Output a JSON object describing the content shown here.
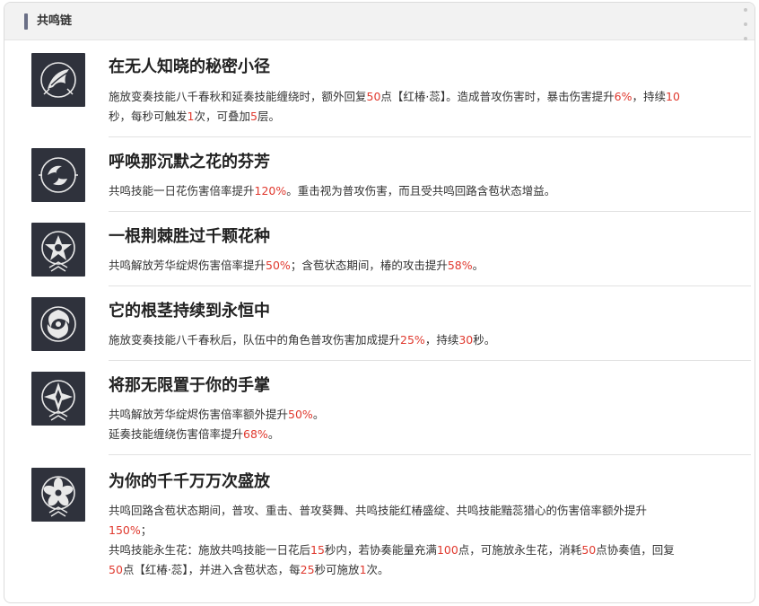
{
  "header": {
    "title": "共鸣链"
  },
  "items": [
    {
      "name": "在无人知晓的秘密小径",
      "icon": "wing-flower-icon",
      "lines": [
        [
          [
            "施放变奏技能八千春秋和延奏技能缠绕时，额外回复",
            false
          ],
          [
            "50",
            true
          ],
          [
            "点【红椿·蕊】。造成普攻伤害时，暴击伤害提升",
            false
          ],
          [
            "6%",
            true
          ],
          [
            "，持续",
            false
          ],
          [
            "10",
            true
          ]
        ],
        [
          [
            "秒，每秒可触发",
            false
          ],
          [
            "1",
            true
          ],
          [
            "次，可叠加",
            false
          ],
          [
            "5",
            true
          ],
          [
            "层。",
            false
          ]
        ]
      ]
    },
    {
      "name": "呼唤那沉默之花的芬芳",
      "icon": "swirl-icon",
      "lines": [
        [
          [
            "共鸣技能一日花伤害倍率提升",
            false
          ],
          [
            "120%",
            true
          ],
          [
            "。重击视为普攻伤害，而且受共鸣回路含苞状态增益。",
            false
          ]
        ]
      ]
    },
    {
      "name": "一根荆棘胜过千颗花种",
      "icon": "star-icon",
      "lines": [
        [
          [
            "共鸣解放芳华绽烬伤害倍率提升",
            false
          ],
          [
            "50%",
            true
          ],
          [
            "；含苞状态期间，椿的攻击提升",
            false
          ],
          [
            "58%",
            true
          ],
          [
            "。",
            false
          ]
        ]
      ]
    },
    {
      "name": "它的根茎持续到永恒中",
      "icon": "vortex-icon",
      "lines": [
        [
          [
            "施放变奏技能八千春秋后，队伍中的角色普攻伤害加成提升",
            false
          ],
          [
            "25%",
            true
          ],
          [
            "，持续",
            false
          ],
          [
            "30",
            true
          ],
          [
            "秒。",
            false
          ]
        ]
      ]
    },
    {
      "name": "将那无限置于你的手掌",
      "icon": "compass-icon",
      "lines": [
        [
          [
            "共鸣解放芳华绽烬伤害倍率额外提升",
            false
          ],
          [
            "50%",
            true
          ],
          [
            "。",
            false
          ]
        ],
        [
          [
            "延奏技能缠绕伤害倍率提升",
            false
          ],
          [
            "68%",
            true
          ],
          [
            "。",
            false
          ]
        ]
      ]
    },
    {
      "name": "为你的千千万万次盛放",
      "icon": "blossom-icon",
      "lines": [
        [
          [
            "共鸣回路含苞状态期间，普攻、重击、普攻葵舞、共鸣技能红椿盛绽、共鸣技能黯蕊猎心的伤害倍率额外提升",
            false
          ]
        ],
        [
          [
            "150%",
            true
          ],
          [
            "；",
            false
          ]
        ],
        [
          [
            "共鸣技能永生花：施放共鸣技能一日花后",
            false
          ],
          [
            "15",
            true
          ],
          [
            "秒内，若协奏能量充满",
            false
          ],
          [
            "100",
            true
          ],
          [
            "点，可施放永生花，消耗",
            false
          ],
          [
            "50",
            true
          ],
          [
            "点协奏值，回复",
            false
          ]
        ],
        [
          [
            "50",
            true
          ],
          [
            "点【红椿·蕊】，并进入含苞状态，每",
            false
          ],
          [
            "25",
            true
          ],
          [
            "秒可施放",
            false
          ],
          [
            "1",
            true
          ],
          [
            "次。",
            false
          ]
        ]
      ]
    }
  ]
}
